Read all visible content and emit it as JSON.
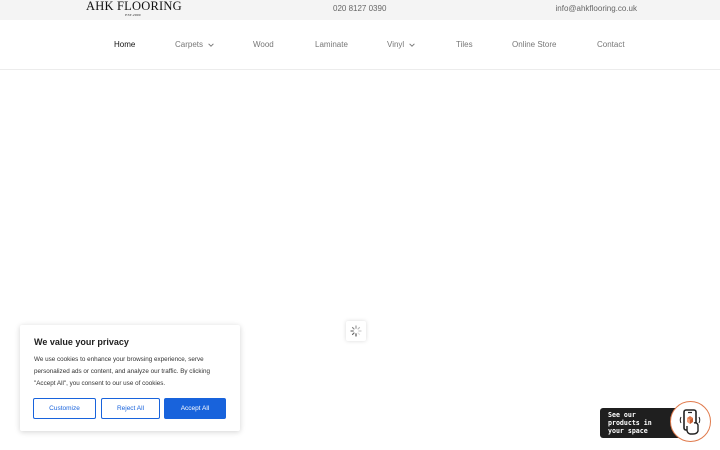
{
  "topbar": {
    "logo_text": "AHK FLOORING",
    "logo_subtext": "EST.2000",
    "phone": "020 8127 0390",
    "email": "info@ahkflooring.co.uk"
  },
  "nav": {
    "items": [
      {
        "label": "Home",
        "active": true
      },
      {
        "label": "Carpets",
        "dropdown": true
      },
      {
        "label": "Wood"
      },
      {
        "label": "Laminate"
      },
      {
        "label": "Vinyl",
        "dropdown": true
      },
      {
        "label": "Tiles"
      },
      {
        "label": "Online Store"
      },
      {
        "label": "Contact"
      }
    ]
  },
  "cookie_banner": {
    "title": "We value your privacy",
    "text": "We use cookies to enhance your browsing experience, serve personalized ads or content, and analyze our traffic. By clicking \"Accept All\", you consent to our use of cookies.",
    "customize_label": "Customize",
    "reject_label": "Reject All",
    "accept_label": "Accept All",
    "accent_color": "#1863dc"
  },
  "ar_widget": {
    "text": "See our products in your space",
    "icon": "phone-ar-icon",
    "accent_color": "#e07a4c"
  },
  "loader": {
    "icon": "spinner-icon"
  }
}
